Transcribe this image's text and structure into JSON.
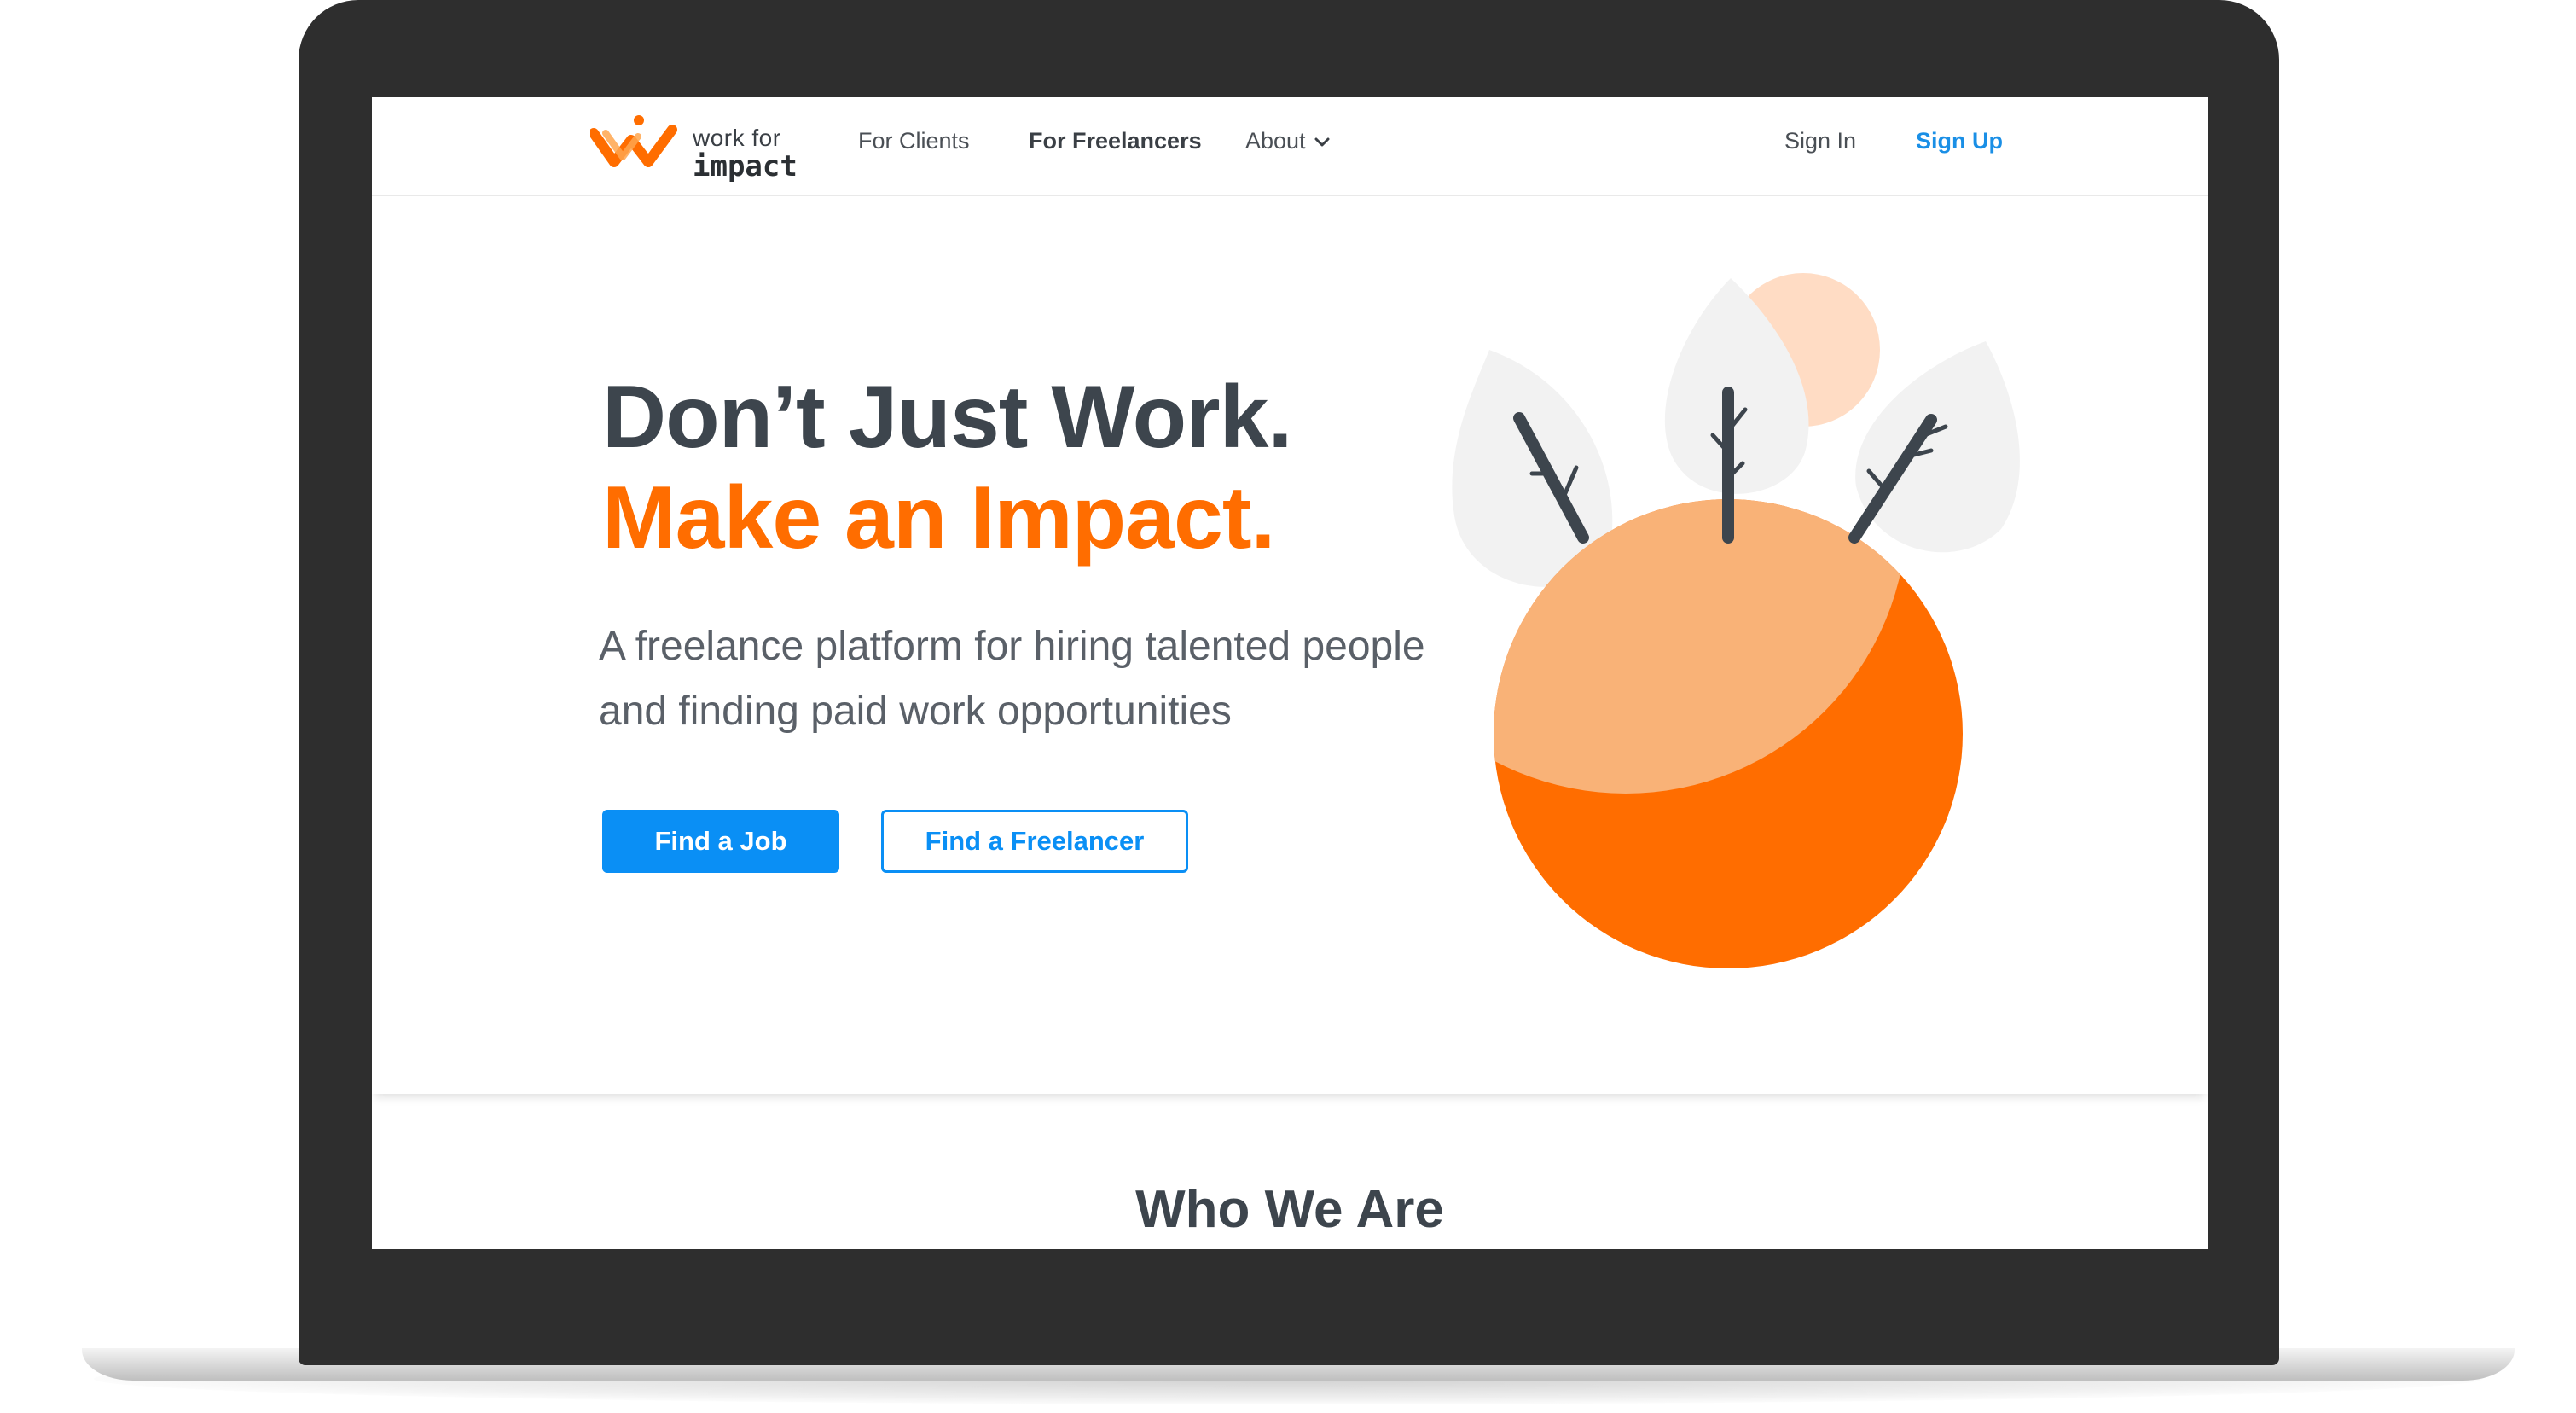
{
  "brand": {
    "logo_line1": "work for",
    "logo_line2": "impact",
    "accent_color": "#ff6d00",
    "link_color": "#0a8ff5"
  },
  "nav": {
    "for_clients": "For Clients",
    "for_freelancers": "For Freelancers",
    "about": "About",
    "sign_in": "Sign In",
    "sign_up": "Sign Up"
  },
  "hero": {
    "headline_line1": "Don’t Just Work.",
    "headline_line2": "Make an Impact.",
    "subtext": "A freelance platform for hiring talented people and finding paid work opportunities",
    "primary_button": "Find a Job",
    "secondary_button": "Find a Freelancer"
  },
  "section": {
    "title": "Who We Are"
  },
  "icons": [
    "logo-mark-icon",
    "chevron-down-icon",
    "planet-with-trees-illustration"
  ]
}
